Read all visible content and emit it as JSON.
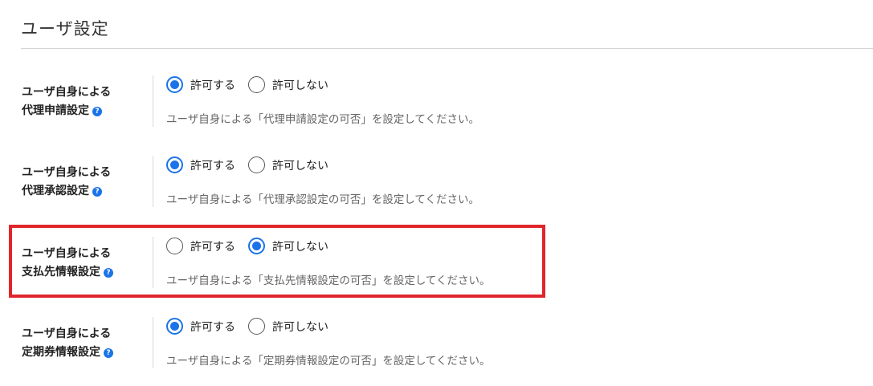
{
  "page": {
    "title": "ユーザ設定"
  },
  "settings": [
    {
      "label_line1": "ユーザ自身による",
      "label_line2": "代理申請設定",
      "option_allow": "許可する",
      "option_deny": "許可しない",
      "selected": "allow",
      "description": "ユーザ自身による「代理申請設定の可否」を設定してください。"
    },
    {
      "label_line1": "ユーザ自身による",
      "label_line2": "代理承認設定",
      "option_allow": "許可する",
      "option_deny": "許可しない",
      "selected": "allow",
      "description": "ユーザ自身による「代理承認設定の可否」を設定してください。"
    },
    {
      "label_line1": "ユーザ自身による",
      "label_line2": "支払先情報設定",
      "option_allow": "許可する",
      "option_deny": "許可しない",
      "selected": "deny",
      "highlighted": true,
      "description": "ユーザ自身による「支払先情報設定の可否」を設定してください。"
    },
    {
      "label_line1": "ユーザ自身による",
      "label_line2": "定期券情報設定",
      "option_allow": "許可する",
      "option_deny": "許可しない",
      "selected": "allow",
      "description": "ユーザ自身による「定期券情報設定の可否」を設定してください。"
    }
  ],
  "help_icon_glyph": "?",
  "colors": {
    "accent": "#1a73e8",
    "highlight_border": "#e0262c"
  }
}
